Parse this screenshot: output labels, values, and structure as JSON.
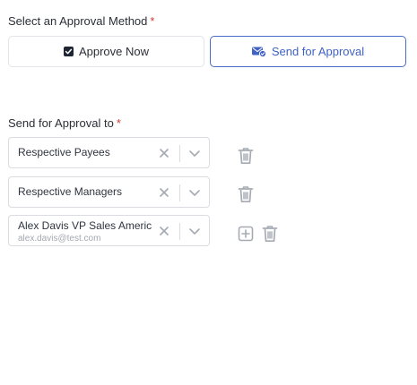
{
  "approval_method": {
    "label": "Select an Approval Method",
    "required_mark": "*",
    "approve_now_label": "Approve Now",
    "send_for_approval_label": "Send for Approval",
    "selected": "send_for_approval"
  },
  "send_to": {
    "label": "Send for Approval to",
    "required_mark": "*",
    "rows": [
      {
        "value": "Respective Payees"
      },
      {
        "value": "Respective Managers"
      },
      {
        "value": "Alex Davis VP Sales Americ",
        "email": "alex.davis@test.com"
      }
    ]
  },
  "colors": {
    "accent": "#3f62c4",
    "required": "#d23b3b",
    "icon_gray": "#a6abb3"
  },
  "icons": {
    "checkbox": "checked-checkbox-icon",
    "send": "mail-check-icon",
    "clear": "close-icon",
    "dropdown": "chevron-down-icon",
    "delete": "trash-icon",
    "add": "plus-square-icon"
  }
}
